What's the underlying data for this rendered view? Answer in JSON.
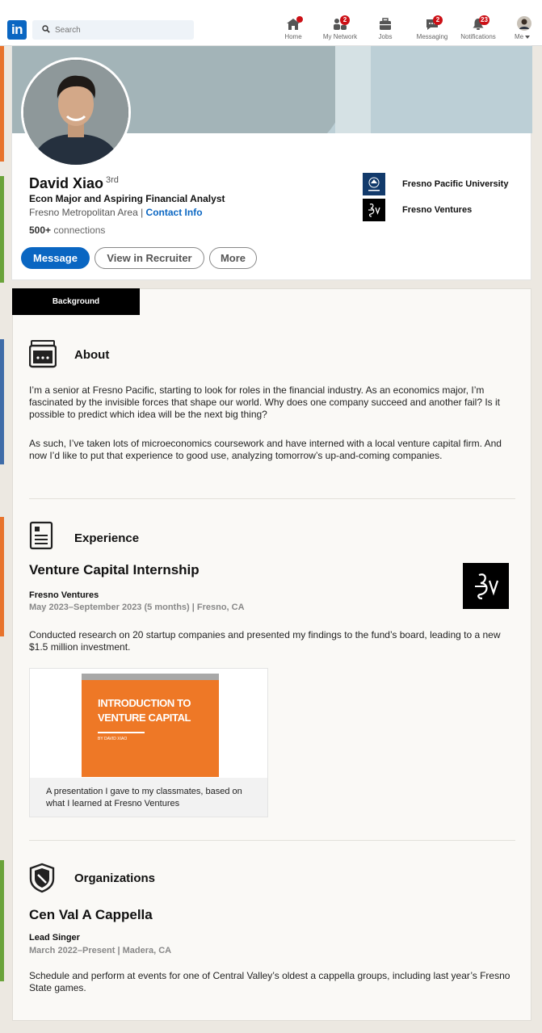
{
  "colors": {
    "brand": "#0a66c2",
    "badge": "#cc1016",
    "slide_orange": "#ee7826",
    "strip_orange": "#e8732c",
    "strip_green": "#6aa33a",
    "strip_blue": "#3f6ca8"
  },
  "nav": {
    "logo_text": "in",
    "search_placeholder": "Search",
    "items": [
      {
        "label": "Home",
        "icon": "home-icon",
        "badge": ""
      },
      {
        "label": "My Network",
        "icon": "network-icon",
        "badge": "2"
      },
      {
        "label": "Jobs",
        "icon": "briefcase-icon",
        "badge": ""
      },
      {
        "label": "Messaging",
        "icon": "messaging-icon",
        "badge": "2"
      },
      {
        "label": "Notifications",
        "icon": "bell-icon",
        "badge": "23"
      },
      {
        "label": "Me",
        "icon": "avatar-icon",
        "badge": ""
      }
    ]
  },
  "profile": {
    "name": "David Xiao",
    "degree": "3rd",
    "headline": "Econ Major and Aspiring Financial Analyst",
    "location": "Fresno Metropolitan Area | ",
    "contact_link": "Contact Info",
    "connections_count": "500+",
    "connections_label": " connections",
    "buttons": {
      "message": "Message",
      "recruiter": "View in Recruiter",
      "more": "More"
    },
    "orgs": [
      {
        "name": "Fresno Pacific University",
        "icon": "university-seal-icon"
      },
      {
        "name": "Fresno Ventures",
        "icon": "fresno-ventures-logo-icon"
      }
    ]
  },
  "background": {
    "tab_label": "Background",
    "about": {
      "title": "About",
      "icon": "id-card-icon",
      "para1": "I’m a senior at Fresno Pacific, starting to look for roles in the financial industry. As an economics major, I’m fascinated by the invisible forces that shape our world. Why does one company succeed and another fail? Is it possible to predict which idea will be the next big thing?",
      "para2": "As such, I’ve taken lots of microeconomics coursework and have interned with a local venture capital firm. And now I’d like to put that experience to good use, analyzing tomorrow’s up-and-coming companies."
    },
    "experience": {
      "title": "Experience",
      "icon": "resume-icon",
      "role": "Venture Capital Internship",
      "company": "Fresno Ventures",
      "dates": "May 2023–September 2023 (5 months) | Fresno, CA",
      "description": "Conducted research on 20 startup companies and presented my findings to the fund’s board, leading to a new $1.5 million investment.",
      "media": {
        "slide_title": "INTRODUCTION TO VENTURE CAPITAL",
        "slide_author": "BY DAVID XIAO",
        "caption": "A presentation I gave to my classmates, based on what I learned at Fresno Ventures"
      }
    },
    "organizations": {
      "title": "Organizations",
      "icon": "shield-badge-icon",
      "name": "Cen Val A Cappella",
      "role": "Lead Singer",
      "dates": "March 2022–Present | Madera, CA",
      "description": "Schedule and perform at events for one of Central Valley’s oldest a cappella groups, including last year’s Fresno State games."
    }
  }
}
